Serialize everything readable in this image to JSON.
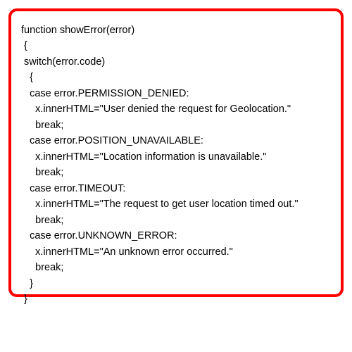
{
  "code": {
    "line1": "function showError(error)",
    "line2": " {",
    "line3": " switch(error.code)",
    "line4": "   {",
    "line5": "   case error.PERMISSION_DENIED:",
    "line6": "     x.innerHTML=\"User denied the request for Geolocation.\"",
    "line7": "     break;",
    "line8": "   case error.POSITION_UNAVAILABLE:",
    "line9": "     x.innerHTML=\"Location information is unavailable.\"",
    "line10": "     break;",
    "line11": "   case error.TIMEOUT:",
    "line12": "     x.innerHTML=\"The request to get user location timed out.\"",
    "line13": "     break;",
    "line14": "   case error.UNKNOWN_ERROR:",
    "line15": "     x.innerHTML=\"An unknown error occurred.\"",
    "line16": "     break;",
    "line17": "   }",
    "line18": " }"
  }
}
